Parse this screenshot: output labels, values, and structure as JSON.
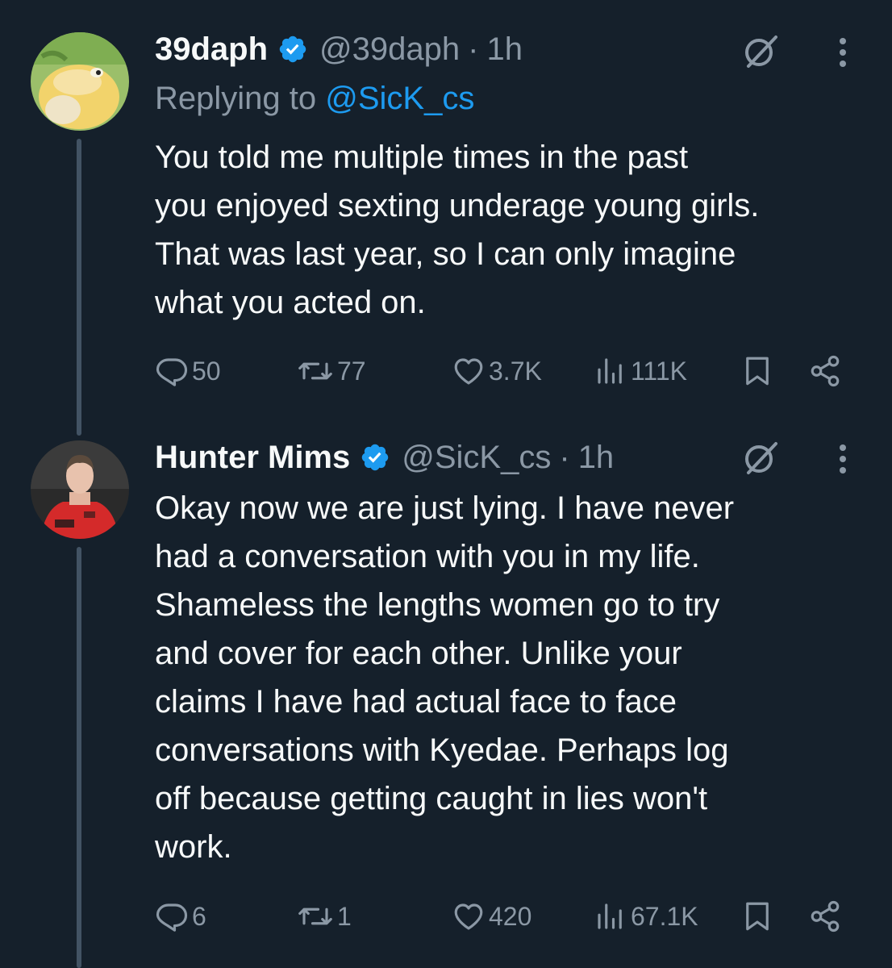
{
  "tweets": [
    {
      "display_name": "39daph",
      "handle": "@39daph",
      "dot": "·",
      "time": "1h",
      "reply_prefix": "Replying to ",
      "reply_mention": "@SicK_cs",
      "text": "You told me multiple times in the past\nyou enjoyed sexting underage young girls.\nThat was last year, so I can only imagine\nwhat you acted on.",
      "replies": "50",
      "retweets": "77",
      "likes": "3.7K",
      "views": "111K"
    },
    {
      "display_name": "Hunter Mims",
      "handle": "@SicK_cs",
      "dot": "·",
      "time": "1h",
      "text": "Okay now we are just lying. I have never\nhad a conversation with you in my life.\nShameless the lengths women go to try\nand cover for each other. Unlike your\nclaims I have had actual face to face\nconversations with Kyedae. Perhaps log\noff because getting caught in lies won't\nwork.",
      "replies": "6",
      "retweets": "1",
      "likes": "420",
      "views": "67.1K"
    }
  ],
  "icons": {
    "reply": "reply-icon",
    "retweet": "retweet-icon",
    "like": "heart-icon",
    "views": "views-icon",
    "bookmark": "bookmark-icon",
    "share": "share-icon",
    "grok": "grok-icon",
    "more": "more-icon",
    "verified": "verified-badge-icon"
  },
  "colors": {
    "background": "#15202b",
    "text": "#f7f9f9",
    "secondary": "#8b98a5",
    "accent": "#1d9bf0",
    "thread_line": "#425364"
  }
}
